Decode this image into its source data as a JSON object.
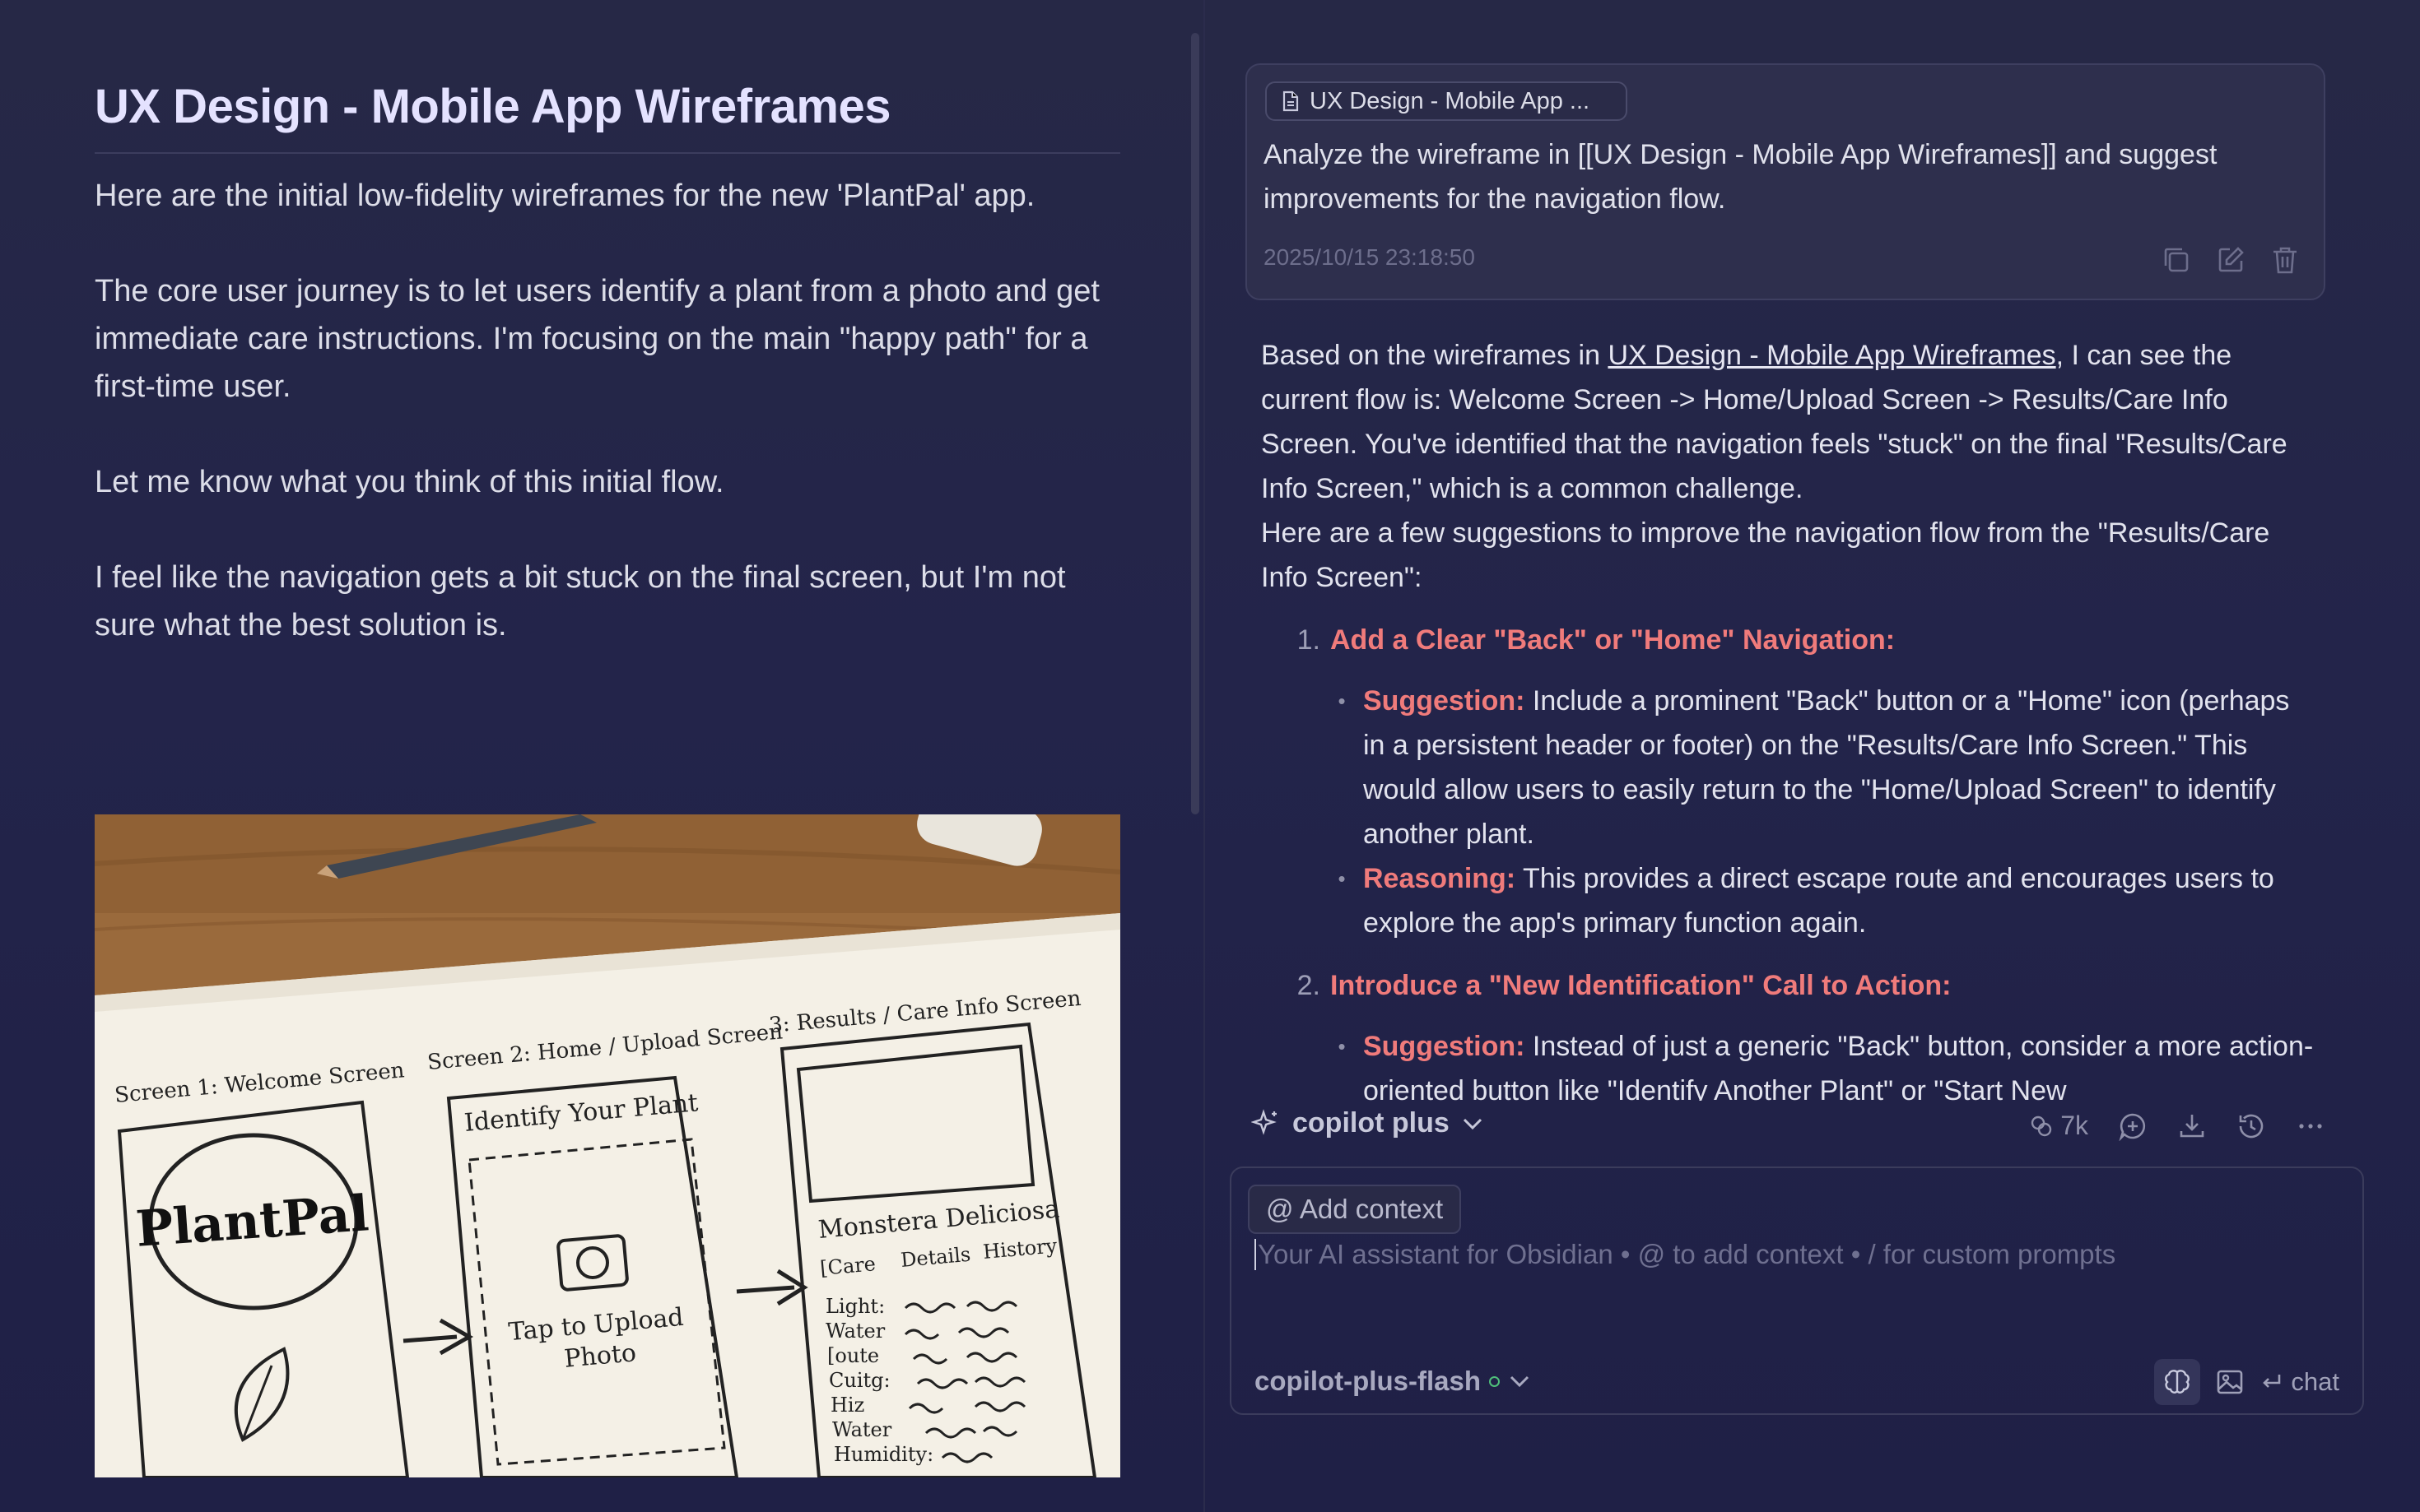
{
  "note": {
    "title": "UX Design - Mobile App Wireframes",
    "paragraphs": [
      "Here are the initial low-fidelity wireframes for the new 'PlantPal' app.",
      "The core user journey is to let users identify a plant from a photo and get immediate care instructions. I'm focusing on the main \"happy path\" for a first-time user.",
      "Let me know what you think of this initial flow.",
      "I feel like the navigation gets a bit stuck on the final screen, but I'm not sure what the best solution is."
    ],
    "sketch": {
      "screen1_label": "Screen 1: Welcome Screen",
      "screen2_label": "Screen 2: Home / Upload Screen",
      "screen3_label": "3: Results / Care Info Screen",
      "logo": "PlantPal",
      "identify": "Identify Your Plant",
      "tap1": "Tap to Upload",
      "tap2": "Photo",
      "plant": "Monstera Deliciosa",
      "tabs": [
        "[Care",
        "Details",
        "History"
      ],
      "rows": [
        "Light:",
        "Water",
        "[oute",
        "Cuitg:",
        "Hiz",
        "Water",
        "Humidity:",
        "Humidity:"
      ]
    }
  },
  "chat": {
    "context_chip": "UX Design - Mobile App ...",
    "user_message": "Analyze the wireframe in [[UX Design - Mobile App Wireframes]] and suggest improvements for the navigation flow.",
    "user_time": "2025/10/15 23:18:50",
    "ai": {
      "intro_pre": "Based on the wireframes in ",
      "intro_link": "UX Design - Mobile App Wireframes",
      "intro_post": ", I can see the current flow is: Welcome Screen -> Home/Upload Screen -> Results/Care Info Screen. You've identified that the navigation feels \"stuck\" on the final \"Results/Care Info Screen,\" which is a common challenge.",
      "intro2": "Here are a few suggestions to improve the navigation flow from the \"Results/Care Info Screen\":",
      "items": [
        {
          "num": "1.",
          "title": "Add a Clear \"Back\" or \"Home\" Navigation:",
          "bullets": [
            {
              "label": "Suggestion:",
              "text": " Include a prominent \"Back\" button or a \"Home\" icon (perhaps in a persistent header or footer) on the \"Results/Care Info Screen.\" This would allow users to easily return to the \"Home/Upload Screen\" to identify another plant."
            },
            {
              "label": "Reasoning:",
              "text": " This provides a direct escape route and encourages users to explore the app's primary function again."
            }
          ]
        },
        {
          "num": "2.",
          "title": "Introduce a \"New Identification\" Call to Action:",
          "bullets": [
            {
              "label": "Suggestion:",
              "text": " Instead of just a generic \"Back\" button, consider a more action-oriented button like \"Identify Another Plant\" or \"Start New"
            }
          ]
        }
      ]
    },
    "toolbar": {
      "model_mode": "copilot plus",
      "tokens": "7k"
    },
    "input": {
      "add_context": "@ Add context",
      "placeholder": "Your AI assistant for Obsidian • @ to add context • / for custom prompts",
      "model": "copilot-plus-flash",
      "send_label": "chat"
    }
  },
  "colors": {
    "accent_red": "#f07b7b",
    "background": "#23244a",
    "status_green": "#4fbf7a"
  }
}
